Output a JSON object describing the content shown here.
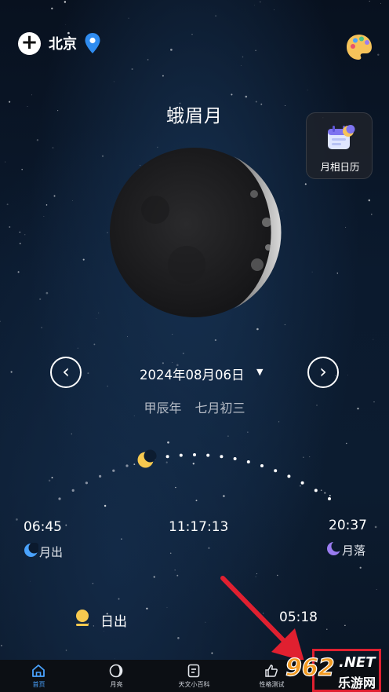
{
  "header": {
    "add_label": "+",
    "city": "北京",
    "pin_icon": "location-pin-icon",
    "theme_icon": "palette-icon"
  },
  "moon_phase": {
    "title": "蛾眉月"
  },
  "calendar_shortcut": {
    "label": "月相日历",
    "icon": "calendar-moon-icon"
  },
  "date_nav": {
    "prev": "‹",
    "next": "›",
    "date": "2024年08月06日",
    "caret": "▼",
    "lunar": "甲辰年 七月初三"
  },
  "moon_track": {
    "rise_time": "06:45",
    "rise_label": "月出",
    "mid_time": "11:17:13",
    "set_time": "20:37",
    "set_label": "月落",
    "progress": 0.33
  },
  "sun": {
    "label": "日出",
    "time": "05:18"
  },
  "tabs": [
    {
      "label": "首页",
      "icon": "home-icon",
      "active": true
    },
    {
      "label": "月亮",
      "icon": "moon-tab-icon",
      "active": false
    },
    {
      "label": "天文小百科",
      "icon": "encyclopedia-icon",
      "active": false
    },
    {
      "label": "性格测试",
      "icon": "thumbs-up-icon",
      "active": false
    },
    {
      "label": "",
      "icon": "profile-icon",
      "active": false
    }
  ],
  "watermark": {
    "brand": "962",
    "net": ".NET",
    "sub": "乐游网"
  },
  "colors": {
    "accent": "#4aa3ff",
    "moonrise_icon": "#4aa3ff",
    "moonset_icon": "#9a7cf0",
    "sun": "#f7c94f",
    "annotation_red": "#e02030"
  }
}
